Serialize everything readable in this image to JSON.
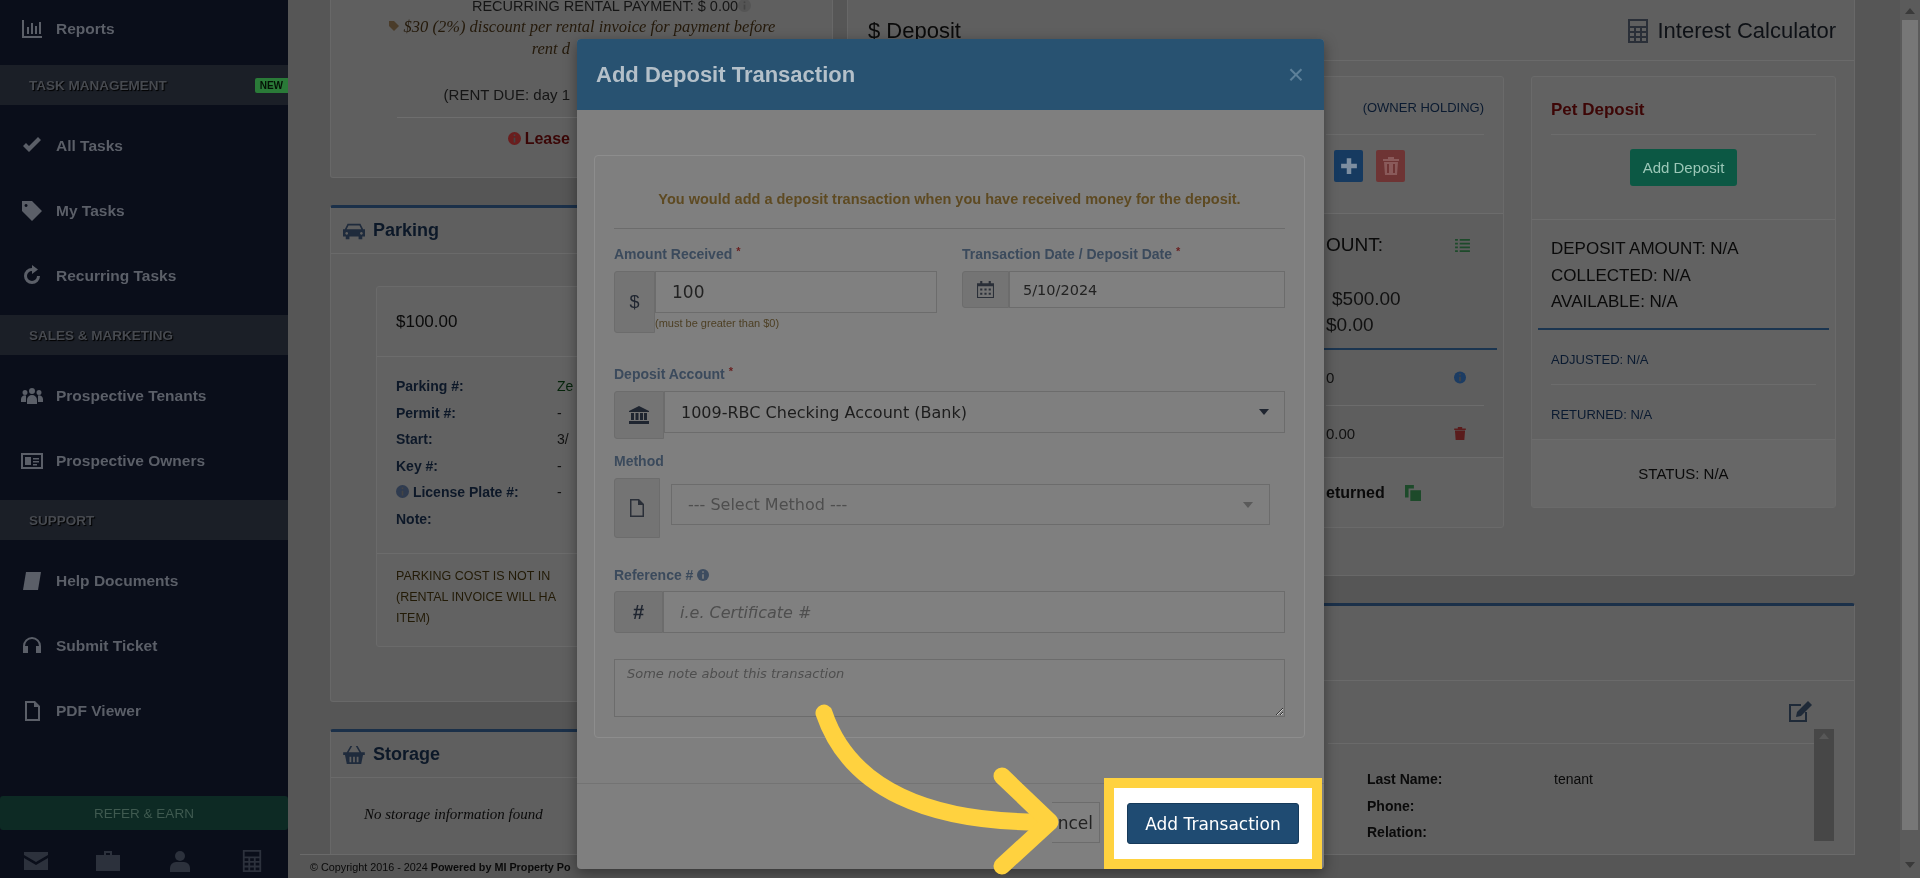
{
  "sidebar": {
    "items": [
      {
        "kind": "link",
        "label": "Reports"
      },
      {
        "kind": "section",
        "label": "TASK MANAGEMENT",
        "badge": "NEW"
      },
      {
        "kind": "link",
        "label": "All Tasks"
      },
      {
        "kind": "link",
        "label": "My Tasks"
      },
      {
        "kind": "link",
        "label": "Recurring Tasks"
      },
      {
        "kind": "section",
        "label": "SALES & MARKETING"
      },
      {
        "kind": "link",
        "label": "Prospective Tenants"
      },
      {
        "kind": "link",
        "label": "Prospective Owners"
      },
      {
        "kind": "section",
        "label": "SUPPORT"
      },
      {
        "kind": "link",
        "label": "Help Documents"
      },
      {
        "kind": "link",
        "label": "Submit Ticket"
      },
      {
        "kind": "link",
        "label": "PDF Viewer"
      }
    ],
    "refer_button": "REFER & EARN"
  },
  "lease_panel": {
    "payment_line": "RECURRING RENTAL PAYMENT: $ 0.00",
    "discount_line_1": "$30 (2%) discount per rental invoice for payment before",
    "discount_line_2": "rent d",
    "rent_due": "(RENT DUE: day 1",
    "lease_link": "Lease"
  },
  "parking": {
    "title": "Parking",
    "amount": "$100.00",
    "rows": [
      {
        "label": "Parking #:",
        "value": "Ze",
        "info": false
      },
      {
        "label": "Permit #:",
        "value": "-",
        "info": false
      },
      {
        "label": "Start:",
        "value": "3/",
        "info": false
      },
      {
        "label": "Key #:",
        "value": "-",
        "info": false
      },
      {
        "label": "License Plate #:",
        "value": "-",
        "info": true
      },
      {
        "label": "Note:",
        "info": false
      }
    ],
    "note_lines": [
      "PARKING COST IS NOT IN",
      "(RENTAL INVOICE WILL HA",
      "ITEM)"
    ]
  },
  "storage": {
    "title": "Storage",
    "empty_text": "No storage information found"
  },
  "footer": {
    "copyright": "© Copyright 2016 - 2024 **Powered by MI Property Po**"
  },
  "deposit_panel": {
    "title": "$ Deposit",
    "calculator_link": "Interest Calculator",
    "security_card": {
      "holding": "(OWNER HOLDING)",
      "amount_label": "OUNT:",
      "lines": [
        "$500.00",
        "$0.00"
      ],
      "rows": [
        "0",
        "0.00"
      ],
      "returned": "eturned"
    },
    "pet_card": {
      "title": "Pet Deposit",
      "button": "Add Deposit",
      "lines": [
        "DEPOSIT AMOUNT: N/A",
        "COLLECTED: N/A",
        "AVAILABLE: N/A"
      ],
      "adjusted": "ADJUSTED: N/A",
      "returned": "RETURNED: N/A",
      "status": "STATUS: N/A"
    }
  },
  "contact_panel": {
    "rows": [
      {
        "label": "Last Name:",
        "value": "tenant"
      },
      {
        "label": "Phone:"
      },
      {
        "label": "Relation:"
      }
    ]
  },
  "modal": {
    "title": "Add Deposit Transaction",
    "close": "×",
    "notice": "You would add a deposit transaction when you have received money for the deposit.",
    "amount": {
      "label": "Amount Received",
      "required_mark": "*",
      "prefix": "$",
      "value": "100",
      "hint": "(must be greater than $0)"
    },
    "date": {
      "label": "Transaction Date / Deposit Date",
      "required_mark": "*",
      "value": "5/10/2024"
    },
    "account": {
      "label": "Deposit Account",
      "required_mark": "*",
      "value": "1009-RBC Checking Account (Bank)"
    },
    "method": {
      "label": "Method",
      "placeholder": "--- Select Method ---"
    },
    "reference": {
      "label": "Reference #",
      "prefix": "#",
      "placeholder": "i.e. Certificate #"
    },
    "note": {
      "placeholder": "Some note about this transaction"
    },
    "cancel_button": "ncel",
    "submit_button": "Add Transaction"
  }
}
